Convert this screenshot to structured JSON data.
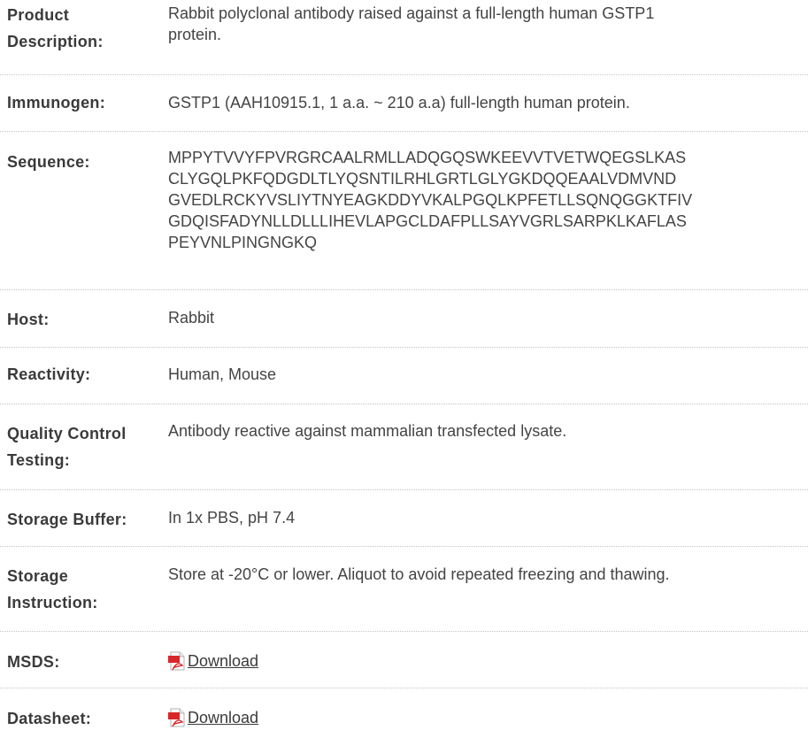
{
  "rows": [
    {
      "label_lines": [
        "Product",
        "Description:"
      ],
      "value_lines": [
        "Rabbit polyclonal antibody raised against a full-length human GSTP1",
        "protein."
      ]
    },
    {
      "label_lines": [
        "Immunogen:"
      ],
      "value_lines": [
        "GSTP1 (AAH10915.1, 1 a.a. ~ 210 a.a) full-length human protein."
      ]
    },
    {
      "label_lines": [
        "Sequence:"
      ],
      "value_lines": [
        "MPPYTVVYFPVRGRCAALRMLLADQGQSWKEEVVTVETWQEGSLKAS",
        "CLYGQLPKFQDGDLTLYQSNTILRHLGRTLGLYGKDQQEAALVDMVND",
        "GVEDLRCKYVSLIYTNYEAGKDDYVKALPGQLKPFETLLSQNQGGKTFIV",
        "GDQISFADYNLLDLLLIHEVLAPGCLDAFPLLSAYVGRLSARPKLKAFLAS",
        "PEYVNLPINGNGKQ"
      ]
    },
    {
      "label_lines": [
        "Host:"
      ],
      "value_lines": [
        "Rabbit"
      ]
    },
    {
      "label_lines": [
        "Reactivity:"
      ],
      "value_lines": [
        "Human, Mouse"
      ]
    },
    {
      "label_lines": [
        "Quality Control",
        "Testing:"
      ],
      "value_lines": [
        "Antibody reactive against mammalian transfected lysate."
      ]
    },
    {
      "label_lines": [
        "Storage Buffer:"
      ],
      "value_lines": [
        "In 1x PBS, pH 7.4"
      ]
    },
    {
      "label_lines": [
        "Storage",
        "Instruction:"
      ],
      "value_lines": [
        "Store at -20°C or lower. Aliquot to avoid repeated freezing and thawing."
      ]
    },
    {
      "label_lines": [
        "MSDS:"
      ],
      "link": "Download",
      "icon": "pdf-icon"
    },
    {
      "label_lines": [
        "Datasheet:"
      ],
      "link": "Download",
      "icon": "pdf-icon"
    }
  ]
}
